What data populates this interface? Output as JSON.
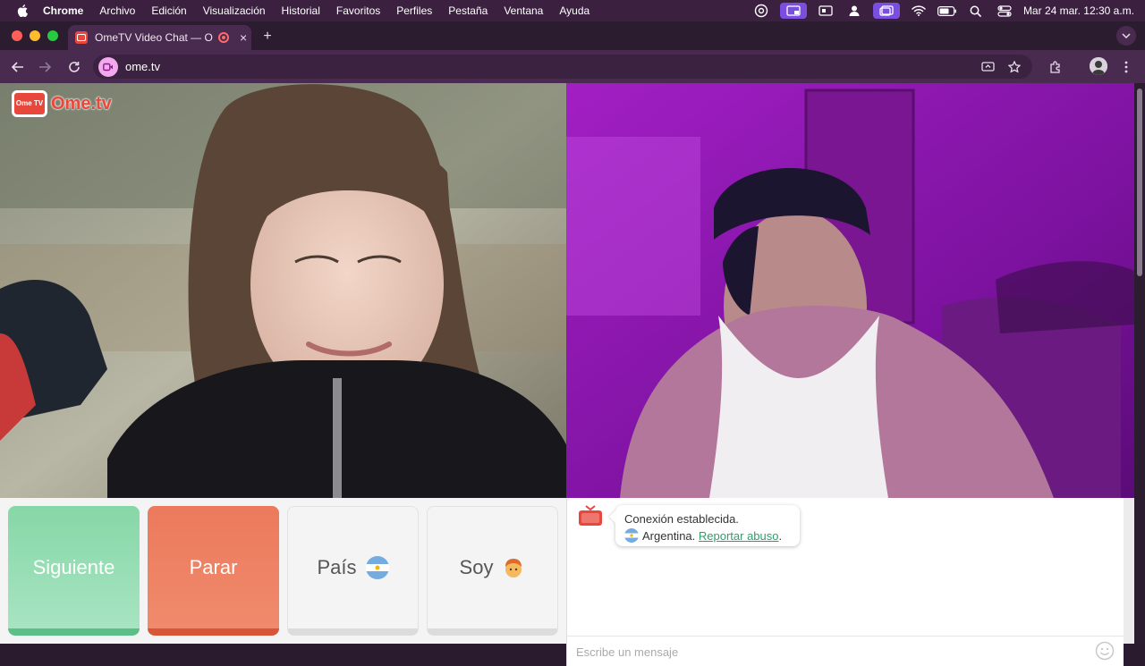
{
  "menubar": {
    "app": "Chrome",
    "items": [
      "Archivo",
      "Edición",
      "Visualización",
      "Historial",
      "Favoritos",
      "Perfiles",
      "Pestaña",
      "Ventana",
      "Ayuda"
    ],
    "clock": "Mar 24 mar.  12:30 a.m."
  },
  "tab": {
    "title": "OmeTV Video Chat — Om",
    "close": "×",
    "new_tab": "+"
  },
  "toolbar": {
    "url": "ome.tv"
  },
  "logo": {
    "tv_text": "Ome TV",
    "word": "Ome.tv"
  },
  "controls": {
    "next_label": "Siguiente",
    "stop_label": "Parar",
    "country_label": "País",
    "i_am_label": "Soy"
  },
  "chat": {
    "connected": "Conexión establecida.",
    "country": "Argentina.",
    "report": "Reportar abuso",
    "report_suffix": ".",
    "input_placeholder": "Escribe un mensaje"
  },
  "colors": {
    "next": "#86d7a7",
    "stop": "#ec7a5c",
    "link": "#2f9e6a",
    "brand": "#e8483c"
  }
}
